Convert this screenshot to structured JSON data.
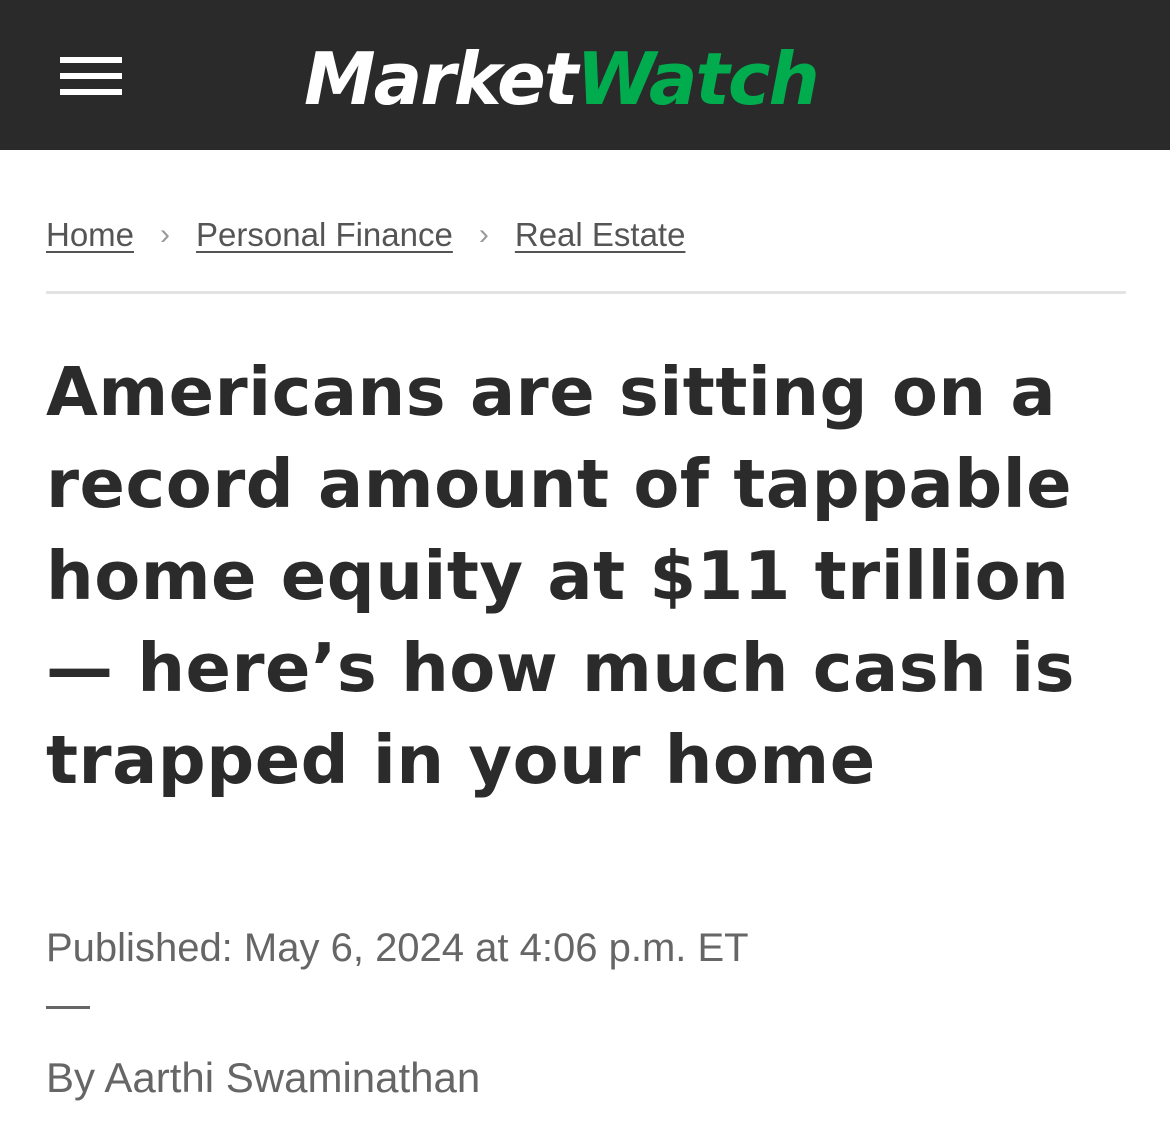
{
  "header": {
    "menu_icon": "hamburger-menu-icon",
    "logo": {
      "part1": "Market",
      "part2": "Watch",
      "part1_color": "#ffffff",
      "part2_color": "#00ac4e"
    },
    "background_color": "#2a2a2a"
  },
  "breadcrumb": {
    "items": [
      {
        "label": "Home"
      },
      {
        "label": "Personal Finance"
      },
      {
        "label": "Real Estate"
      }
    ],
    "separator_icon": "chevron-right-icon"
  },
  "article": {
    "headline": "Americans are sitting on a record amount of tappable home equity at $11 trillion — here’s how much cash is trapped in your home",
    "published": "Published: May 6, 2024 at 4:06 p.m. ET",
    "byline": "By Aarthi Swaminathan"
  }
}
